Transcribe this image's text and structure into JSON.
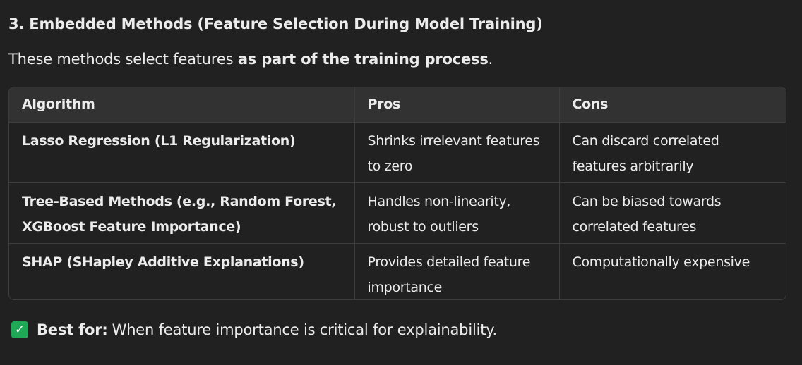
{
  "section": {
    "heading": "3. Embedded Methods (Feature Selection During Model Training)",
    "intro_prefix": "These methods select features ",
    "intro_bold": "as part of the training process",
    "intro_suffix": "."
  },
  "table": {
    "headers": [
      "Algorithm",
      "Pros",
      "Cons"
    ],
    "rows": [
      {
        "algorithm": "Lasso Regression (L1 Regularization)",
        "pros": "Shrinks irrelevant features to zero",
        "cons": "Can discard correlated features arbitrarily"
      },
      {
        "algorithm": "Tree-Based Methods (e.g., Random Forest, XGBoost Feature Importance)",
        "pros": "Handles non-linearity, robust to outliers",
        "cons": "Can be biased towards correlated features"
      },
      {
        "algorithm": "SHAP (SHapley Additive Explanations)",
        "pros": "Provides detailed feature importance",
        "cons": "Computationally expensive"
      }
    ]
  },
  "best_for": {
    "icon": "check-mark-icon",
    "label": "Best for:",
    "text": "When feature importance is critical for explainability."
  },
  "colors": {
    "background": "#212121",
    "header_row": "#323232",
    "border": "#3d3d3d",
    "check_green": "#1fa855",
    "text": "#ececec"
  }
}
